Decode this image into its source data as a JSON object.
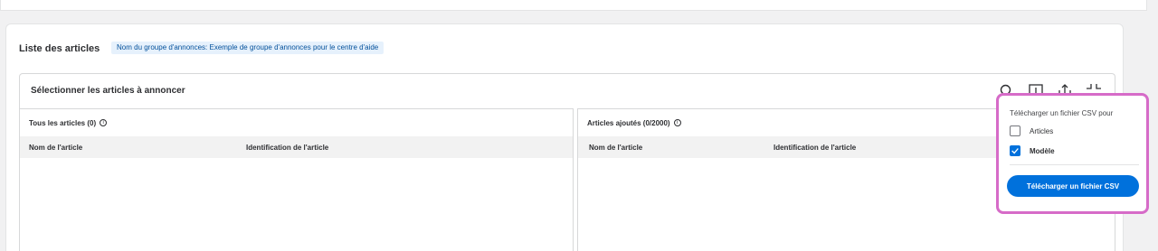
{
  "card": {
    "title": "Liste des articles",
    "chip": "Nom du groupe d'annonces: Exemple de groupe d'annonces pour le centre d'aide"
  },
  "panel": {
    "title": "Sélectionner les articles à annoncer",
    "icons": [
      "search-icon",
      "download-icon",
      "upload-icon",
      "collapse-icon"
    ]
  },
  "left_pane": {
    "header": "Tous les articles (0)",
    "columns": [
      "Nom de l'article",
      "Identification de l'article"
    ]
  },
  "right_pane": {
    "header": "Articles ajoutés (0/2000)",
    "columns": [
      "Nom de l'article",
      "Identification de l'article"
    ]
  },
  "popover": {
    "title": "Télécharger un fichier CSV pour",
    "options": [
      {
        "label": "Articles",
        "checked": false
      },
      {
        "label": "Modèle",
        "checked": true
      }
    ],
    "button": "Télécharger un fichier CSV",
    "border_color": "#d66bc8",
    "accent": "#0071dc"
  }
}
